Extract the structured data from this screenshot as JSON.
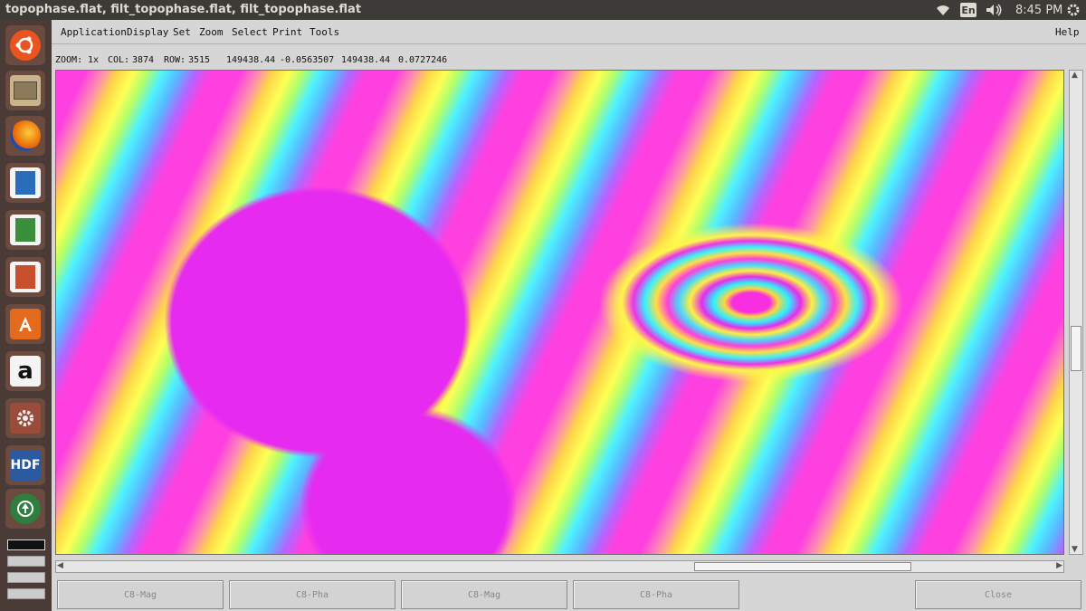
{
  "window": {
    "title": "topophase.flat, filt_topophase.flat, filt_topophase.flat"
  },
  "topbar": {
    "lang": "En",
    "time": "8:45 PM"
  },
  "menu": [
    "Application",
    "Display",
    "Set",
    "Zoom",
    "Select",
    "Print",
    "Tools"
  ],
  "help_label": "Help",
  "status": {
    "zoom_label": "ZOOM:",
    "zoom_value": "1x",
    "col_label": "COL:",
    "col_value": "3874",
    "row_label": "ROW:",
    "row_value": "3515",
    "val1": "149438.44",
    "val2": "-0.0563507",
    "val3": "149438.44",
    "val4": "0.0727246"
  },
  "buttons": [
    "C8-Mag",
    "C8-Pha",
    "C8-Mag",
    "C8-Pha",
    "Close"
  ],
  "launcher": [
    {
      "name": "ubuntu",
      "color": "#e95420"
    },
    {
      "name": "files",
      "color": "#d6b77c"
    },
    {
      "name": "firefox",
      "color": "#f28d1b"
    },
    {
      "name": "writer",
      "color": "#2a6ebb"
    },
    {
      "name": "calc",
      "color": "#3b8e3b"
    },
    {
      "name": "impress",
      "color": "#c84f2d"
    },
    {
      "name": "software-center",
      "color": "#e46a1e"
    },
    {
      "name": "amazon",
      "color": "#ffffff"
    },
    {
      "name": "settings",
      "color": "#b24b35"
    },
    {
      "name": "hdf",
      "color": "#2c5aa0"
    },
    {
      "name": "updater",
      "color": "#2f7d3f"
    }
  ]
}
